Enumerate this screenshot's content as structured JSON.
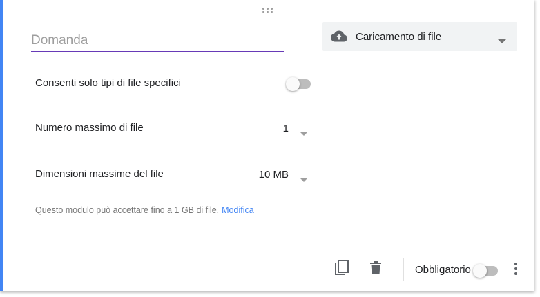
{
  "question": {
    "placeholder": "Domanda",
    "value": ""
  },
  "question_type": {
    "icon": "cloud-upload-icon",
    "selected": "Caricamento di file"
  },
  "settings": {
    "specific_types_label": "Consenti solo tipi di file specifici",
    "specific_types_enabled": false,
    "max_files_label": "Numero massimo di file",
    "max_files_value": "1",
    "max_size_label": "Dimensioni massime del file",
    "max_size_value": "10 MB"
  },
  "hint": {
    "text": "Questo modulo può accettare fino a 1 GB di file.",
    "link": "Modifica"
  },
  "footer": {
    "duplicate_icon": "copy-icon",
    "delete_icon": "trash-icon",
    "required_label": "Obbligatorio",
    "required_enabled": false,
    "more_icon": "more-vert-icon"
  },
  "colors": {
    "accent": "#673ab7",
    "card_edge": "#4285f4",
    "link": "#4285f4"
  }
}
